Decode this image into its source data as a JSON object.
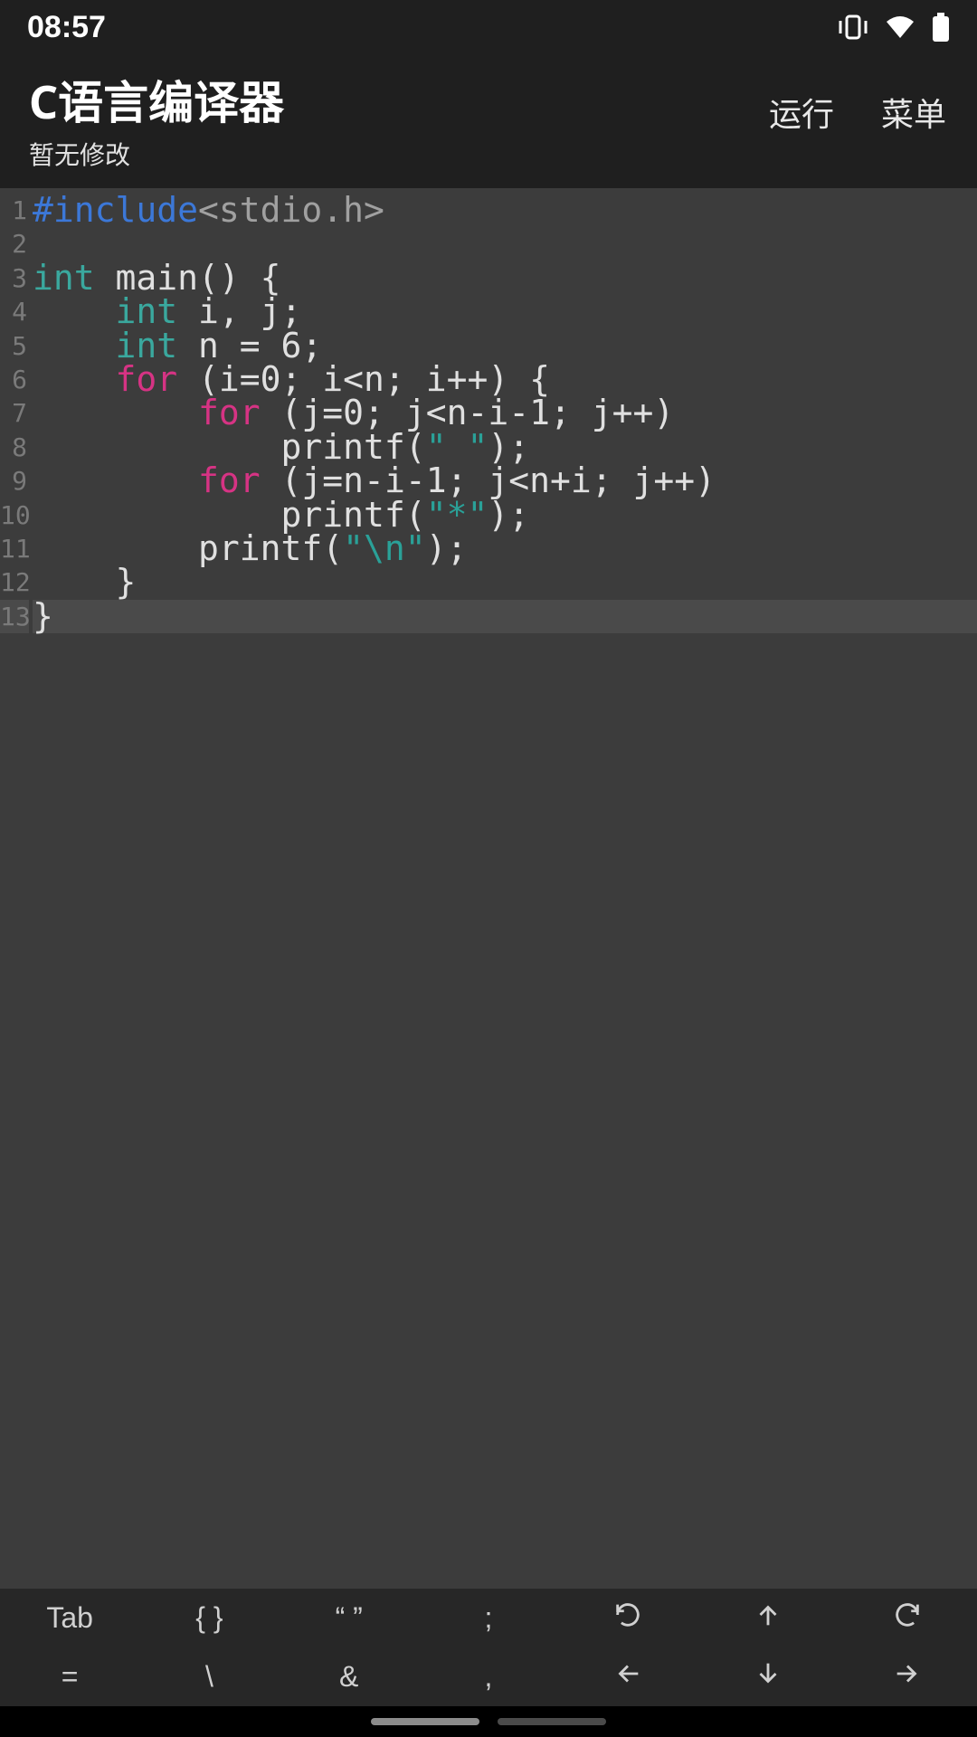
{
  "status": {
    "time": "08:57"
  },
  "header": {
    "title": "C语言编译器",
    "subtitle": "暂无修改",
    "run_label": "运行",
    "menu_label": "菜单"
  },
  "editor": {
    "line_numbers": [
      "1",
      "2",
      "3",
      "4",
      "5",
      "6",
      "7",
      "8",
      "9",
      "10",
      "11",
      "12",
      "13"
    ],
    "current_line": 13,
    "code": {
      "l1_include": "#include",
      "l1_header": "<stdio.h>",
      "l3_int": "int",
      "l3_rest": " main() {",
      "l4_pad": "    ",
      "l4_int": "int",
      "l4_rest": " i, j;",
      "l5_pad": "    ",
      "l5_int": "int",
      "l5_rest": " n = 6;",
      "l6_pad": "    ",
      "l6_for": "for",
      "l6_rest": " (i=0; i<n; i++) {",
      "l7_pad": "        ",
      "l7_for": "for",
      "l7_rest": " (j=0; j<n-i-1; j++)",
      "l8_pad": "            printf(",
      "l8_str": "\" \"",
      "l8_end": ");",
      "l9_pad": "        ",
      "l9_for": "for",
      "l9_rest": " (j=n-i-1; j<n+i; j++)",
      "l10_pad": "            printf(",
      "l10_str": "\"*\"",
      "l10_end": ");",
      "l11_pad": "        printf(",
      "l11_str": "\"\\n\"",
      "l11_end": ");",
      "l12": "    }",
      "l13": "}"
    }
  },
  "toolbar": {
    "r1": {
      "k0": "Tab",
      "k1": "{ }",
      "k2": "“ ”",
      "k3": ";"
    },
    "r2": {
      "k0": "=",
      "k1": "\\",
      "k2": "&",
      "k3": ","
    }
  }
}
